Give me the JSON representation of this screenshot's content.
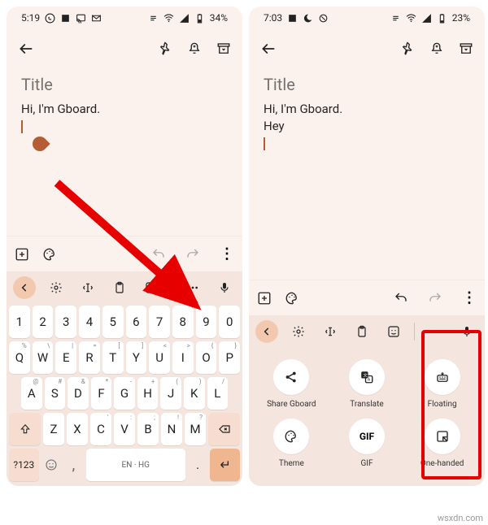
{
  "left": {
    "status": {
      "time": "5:19",
      "battery": "34%"
    },
    "title_placeholder": "Title",
    "note_text": "Hi, I'm Gboard.",
    "toolbar": {
      "more": "⋮"
    },
    "kb": {
      "row_num": [
        "1",
        "2",
        "3",
        "4",
        "5",
        "6",
        "7",
        "8",
        "9",
        "0"
      ],
      "row_q": [
        "Q",
        "W",
        "E",
        "R",
        "T",
        "Y",
        "U",
        "I",
        "O",
        "P"
      ],
      "row_q_sup": [
        "%",
        "\\",
        "|",
        "=",
        "[",
        "]",
        "<",
        ">",
        "{",
        "}"
      ],
      "row_a": [
        "A",
        "S",
        "D",
        "F",
        "G",
        "H",
        "J",
        "K",
        "L"
      ],
      "row_a_sup": [
        "@",
        "#",
        "&",
        "*",
        "-",
        "+",
        "(",
        ")",
        "/"
      ],
      "row_z": [
        "Z",
        "X",
        "C",
        "V",
        "B",
        "N",
        "M"
      ],
      "row_z_sup": [
        "",
        "",
        "'",
        ":",
        ";",
        "!",
        "?"
      ],
      "sym": "?123",
      "lang": "EN · HG",
      "period": "."
    }
  },
  "right": {
    "status": {
      "time": "7:03",
      "battery": "23%"
    },
    "title_placeholder": "Title",
    "note_line1": "Hi, I'm Gboard.",
    "note_line2": "Hey",
    "grid": {
      "share": "Share Gboard",
      "translate": "Translate",
      "floating": "Floating",
      "theme": "Theme",
      "gif": "GIF",
      "onehanded": "One-handed"
    }
  },
  "watermark": "wsxdn.com"
}
